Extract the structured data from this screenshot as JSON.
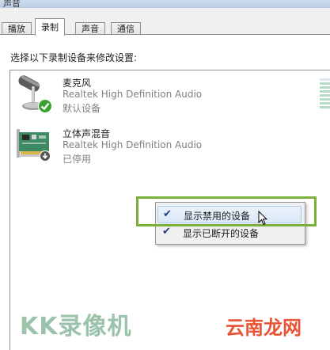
{
  "window": {
    "title": "声音"
  },
  "tabs": [
    {
      "label": "播放"
    },
    {
      "label": "录制"
    },
    {
      "label": "声音"
    },
    {
      "label": "通信"
    }
  ],
  "instruction": "选择以下录制设备来修改设置:",
  "devices": [
    {
      "name": "麦克风",
      "driver": "Realtek High Definition Audio",
      "status": "默认设备",
      "icon": "microphone-icon",
      "badge": "default-check-badge"
    },
    {
      "name": "立体声混音",
      "driver": "Realtek High Definition Audio",
      "status": "已停用",
      "icon": "sound-card-icon",
      "badge": "disabled-arrow-badge"
    }
  ],
  "context_menu": {
    "items": [
      {
        "label": "显示禁用的设备",
        "checked": true,
        "hovered": true
      },
      {
        "label": "显示已断开的设备",
        "checked": true,
        "hovered": false
      }
    ]
  },
  "watermarks": {
    "left": "KK录像机",
    "right": "云南龙网"
  },
  "colors": {
    "highlight": "#7ab03a",
    "check": "#1c3d83",
    "default_badge": "#3aa12e"
  }
}
